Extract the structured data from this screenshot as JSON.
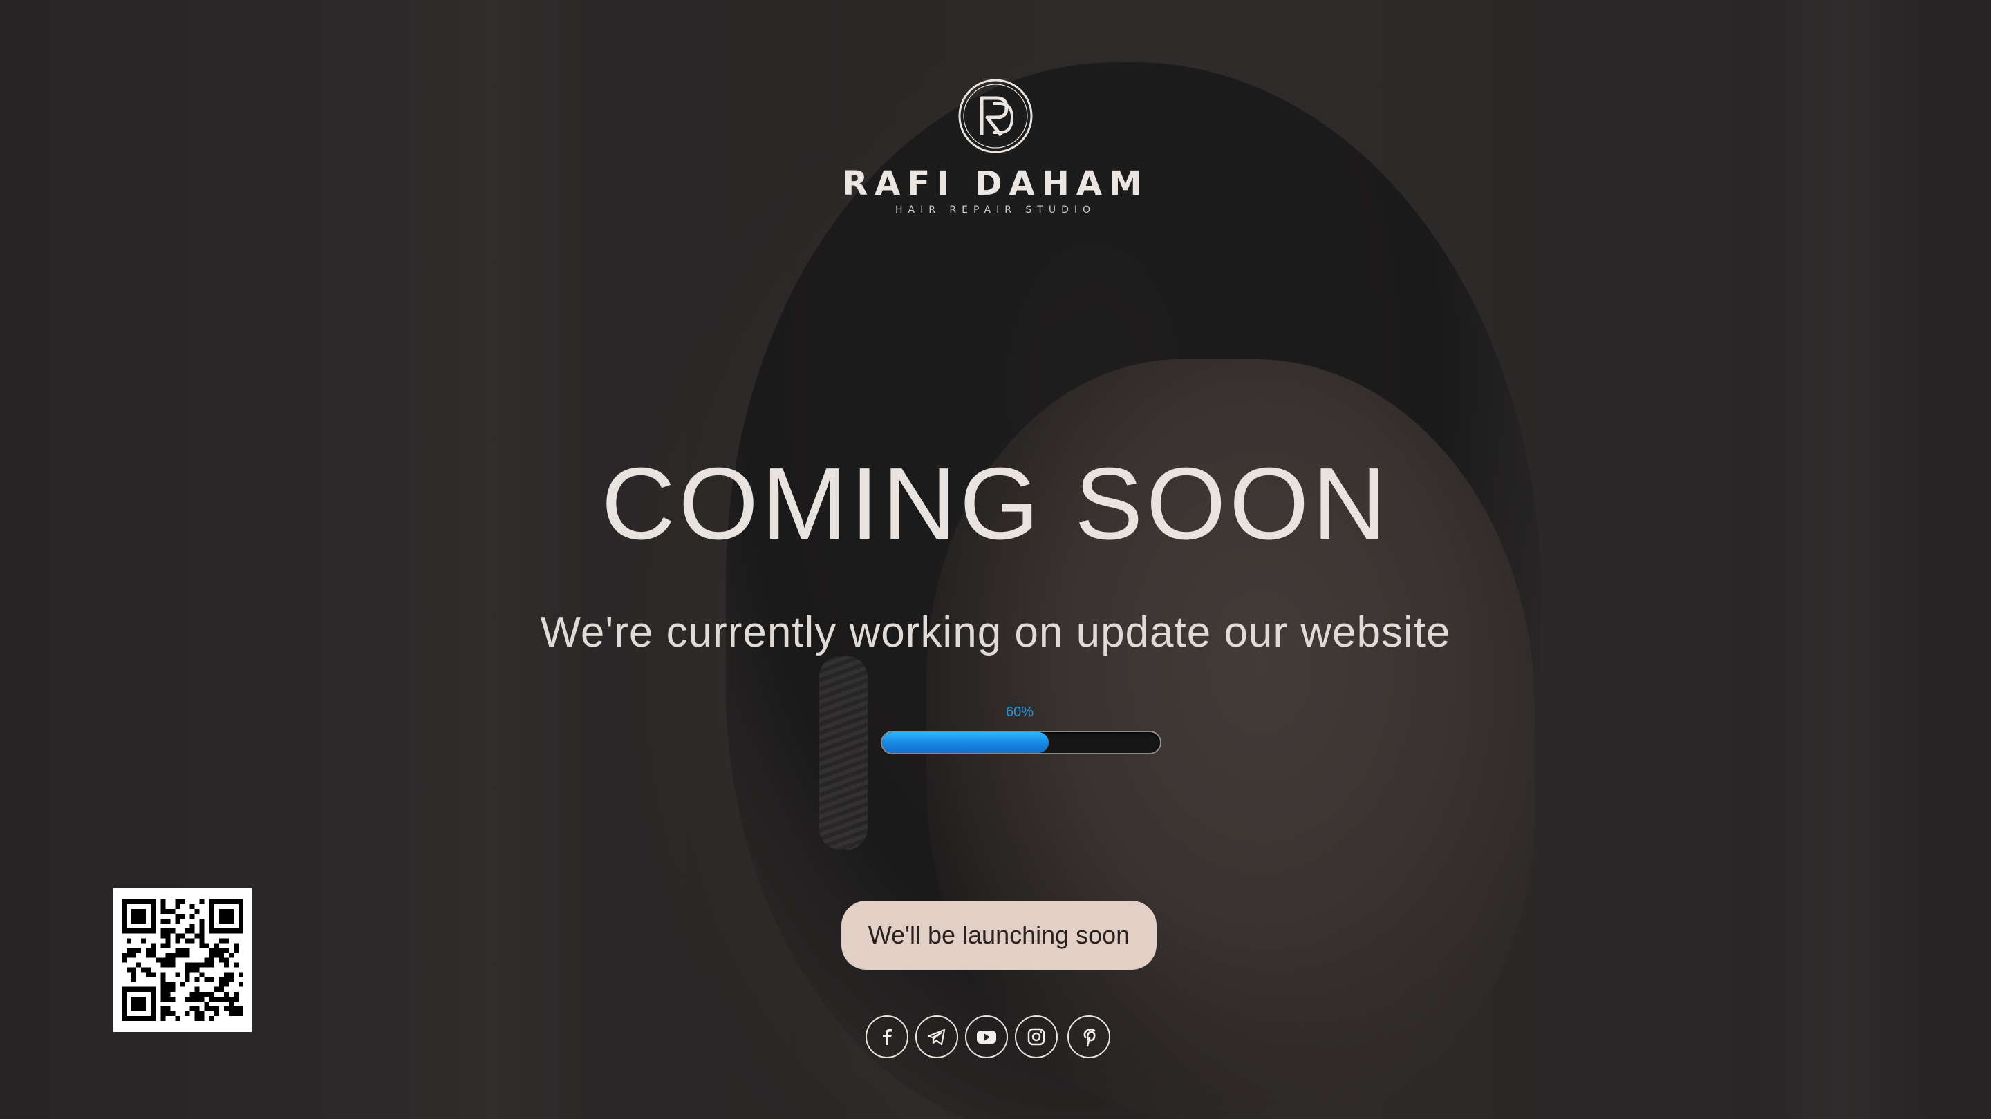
{
  "brand": {
    "monogram": "RD",
    "name": "RAFI DAHAM",
    "tagline": "HAIR REPAIR STUDIO"
  },
  "hero": {
    "title": "COMING SOON",
    "subtitle": "We're currently working on update our website"
  },
  "progress": {
    "label": "60%",
    "value": 0.6,
    "fill_color": "#1a8ee6"
  },
  "cta": {
    "label": "We'll be launching soon",
    "background": "#e2cfc6"
  },
  "social_links": [
    {
      "name": "facebook",
      "icon": "facebook-icon"
    },
    {
      "name": "telegram",
      "icon": "telegram-icon"
    },
    {
      "name": "youtube",
      "icon": "youtube-icon"
    },
    {
      "name": "instagram",
      "icon": "instagram-icon"
    },
    {
      "name": "pinterest",
      "icon": "pinterest-icon"
    }
  ],
  "qr_code": {
    "icon": "qr-code"
  }
}
